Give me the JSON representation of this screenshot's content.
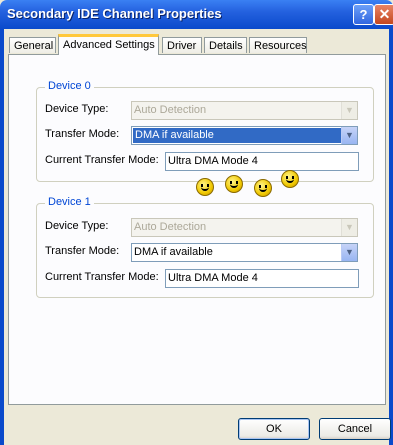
{
  "window": {
    "title": "Secondary IDE Channel Properties",
    "help_glyph": "?",
    "close_glyph": "✕"
  },
  "tabs": [
    {
      "label": "General",
      "active": false
    },
    {
      "label": "Advanced Settings",
      "active": true
    },
    {
      "label": "Driver",
      "active": false
    },
    {
      "label": "Details",
      "active": false
    },
    {
      "label": "Resources",
      "active": false
    }
  ],
  "device0": {
    "legend": "Device 0",
    "device_type_label": "Device Type:",
    "device_type_value": "Auto Detection",
    "transfer_mode_label": "Transfer Mode:",
    "transfer_mode_value": "DMA if available",
    "current_mode_label": "Current Transfer Mode:",
    "current_mode_value": "Ultra DMA Mode 4"
  },
  "device1": {
    "legend": "Device 1",
    "device_type_label": "Device Type:",
    "device_type_value": "Auto Detection",
    "transfer_mode_label": "Transfer Mode:",
    "transfer_mode_value": "DMA if available",
    "current_mode_label": "Current Transfer Mode:",
    "current_mode_value": "Ultra DMA Mode 4"
  },
  "icons": {
    "dropdown": "chevron-down-icon",
    "decoration": "smiley-face-icon"
  },
  "buttons": {
    "ok": "OK",
    "cancel": "Cancel"
  }
}
